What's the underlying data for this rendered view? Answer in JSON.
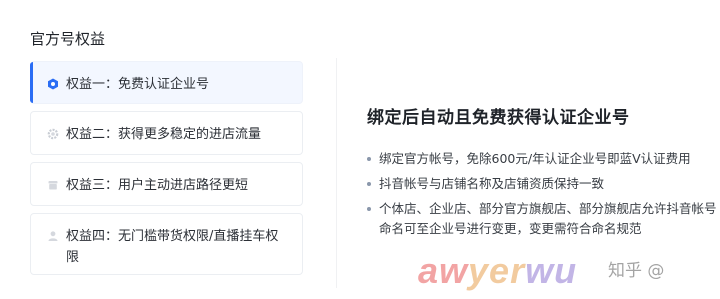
{
  "section_title": "官方号权益",
  "benefits": [
    {
      "label": "权益一：免费认证企业号",
      "icon": "hexagon-badge-icon",
      "active": true
    },
    {
      "label": "权益二：获得更多稳定的进店流量",
      "icon": "gear-icon",
      "active": false
    },
    {
      "label": "权益三：用户主动进店路径更短",
      "icon": "store-icon",
      "active": false
    },
    {
      "label": "权益四：无门槛带货权限/直播挂车权限",
      "icon": "user-icon",
      "active": false
    }
  ],
  "detail": {
    "title": "绑定后自动且免费获得认证企业号",
    "bullets": [
      "绑定官方帐号，免除600元/年认证企业号即蓝V认证费用",
      "抖音帐号与店铺名称及店铺资质保持一致",
      "个体店、企业店、部分官方旗舰店、部分旗舰店允许抖音帐号命名可至企业号进行变更，变更需符合命名规范"
    ]
  },
  "colors": {
    "accent": "#2a6df4",
    "active_bg": "#f3f7ff",
    "border": "#ebeef2"
  },
  "watermark": {
    "text": "awyerwu.com",
    "source": "知乎 @"
  }
}
